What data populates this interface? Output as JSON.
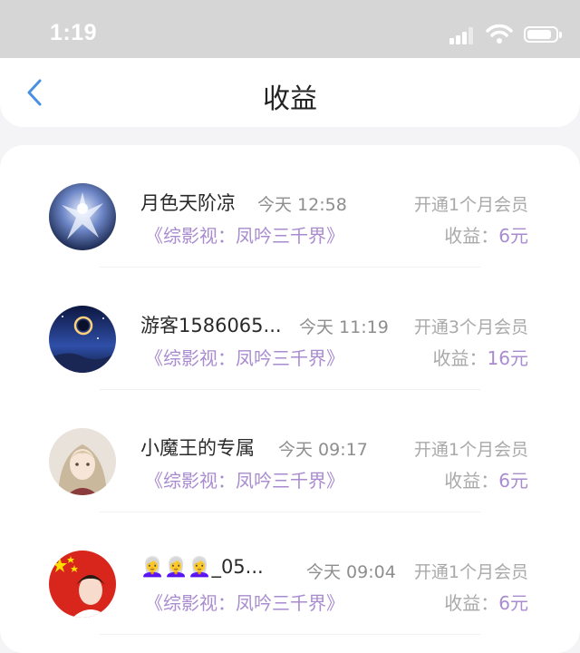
{
  "status_bar": {
    "time": "1:19"
  },
  "nav": {
    "title": "收益",
    "back_icon": "chevron-left-icon",
    "accent": "#4a90e2"
  },
  "colors": {
    "purple": "#a98bd0",
    "gray": "#a9a9a9"
  },
  "earnings": [
    {
      "name": "月色天阶凉",
      "time": "今天 12:58",
      "desc": "开通1个月会员",
      "title": "《综影视：凤吟三千界》",
      "earn_label": "收益：",
      "earn_amount": "6元"
    },
    {
      "name": "游客1586065...",
      "time": "今天 11:19",
      "desc": "开通3个月会员",
      "title": "《综影视：凤吟三千界》",
      "earn_label": "收益：",
      "earn_amount": "16元"
    },
    {
      "name": "小魔王的专属",
      "time": "今天 09:17",
      "desc": "开通1个月会员",
      "title": "《综影视：凤吟三千界》",
      "earn_label": "收益：",
      "earn_amount": "6元"
    },
    {
      "name": "👩‍🦳👩‍🦳👩‍🦳_05...",
      "time": "今天 09:04",
      "desc": "开通1个月会员",
      "title": "《综影视：凤吟三千界》",
      "earn_label": "收益：",
      "earn_amount": "6元"
    }
  ]
}
